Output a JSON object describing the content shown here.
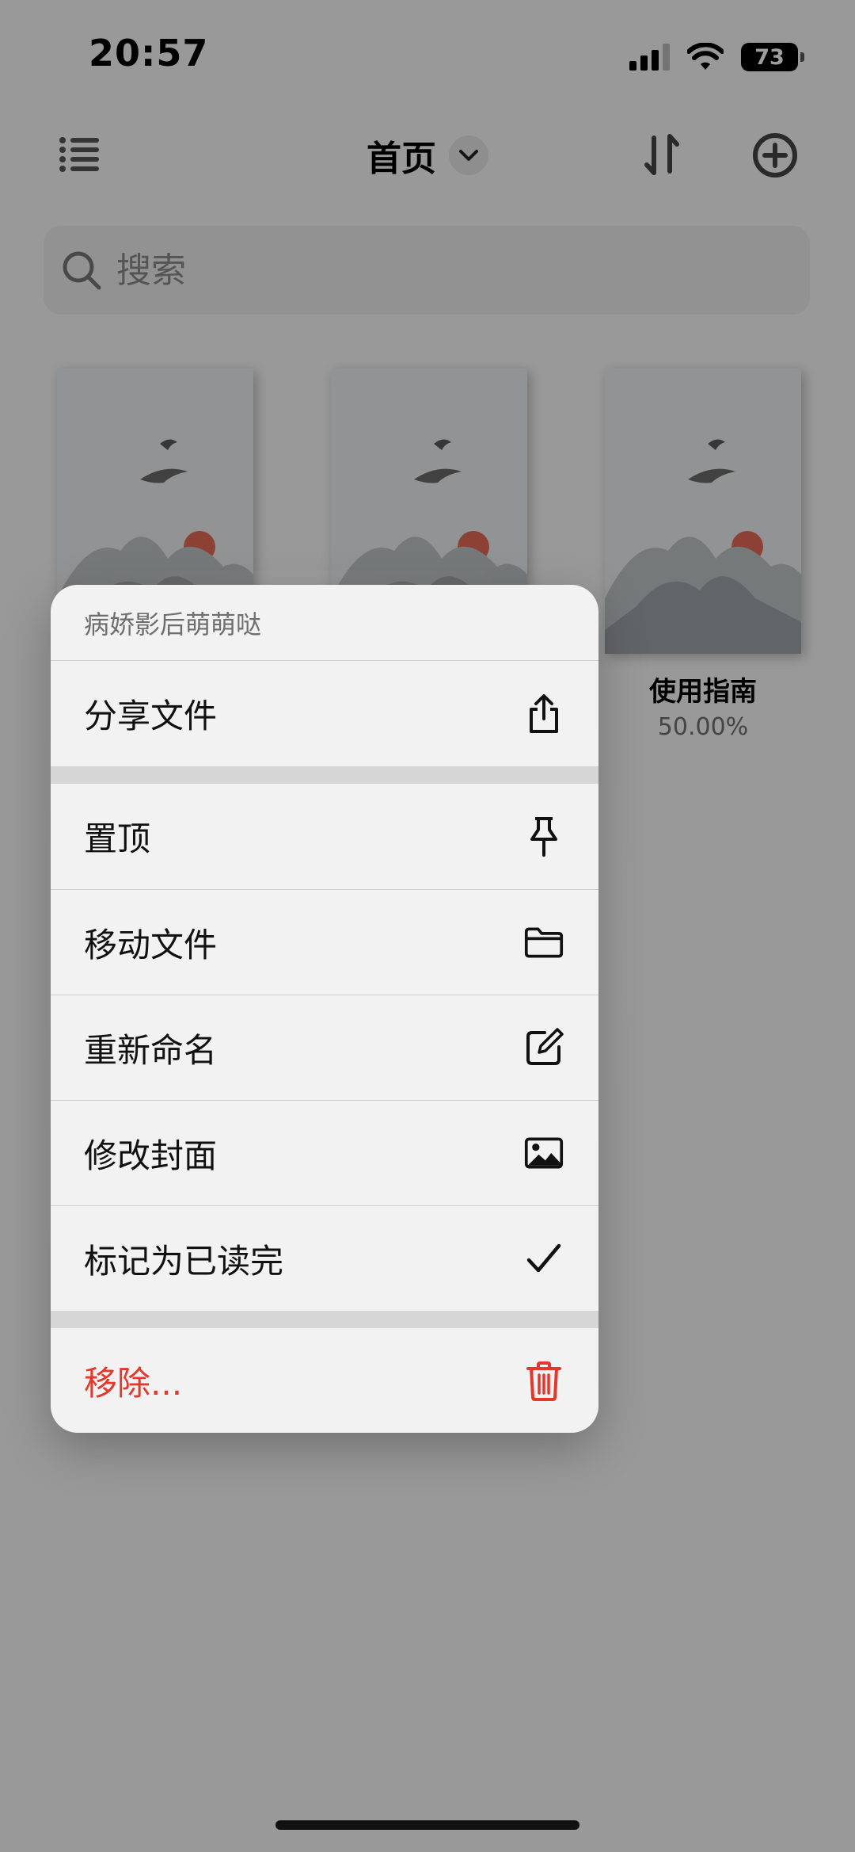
{
  "status_bar": {
    "time": "20:57",
    "battery": "73"
  },
  "nav": {
    "title": "首页",
    "icons": [
      "list-icon",
      "chevron-down-icon",
      "sort-icon",
      "add-circle-icon"
    ]
  },
  "search": {
    "placeholder": "搜索"
  },
  "books": [
    {
      "title": "",
      "progress": ""
    },
    {
      "title": "",
      "progress": ""
    },
    {
      "title": "使用指南",
      "progress": "50.00%"
    }
  ],
  "context_menu": {
    "header": "病娇影后萌萌哒",
    "items": [
      {
        "label": "分享文件",
        "icon": "share-icon"
      },
      {
        "label": "置顶",
        "icon": "pin-icon"
      },
      {
        "label": "移动文件",
        "icon": "folder-icon"
      },
      {
        "label": "重新命名",
        "icon": "edit-icon"
      },
      {
        "label": "修改封面",
        "icon": "image-icon"
      },
      {
        "label": "标记为已读完",
        "icon": "checkmark-icon"
      },
      {
        "label": "移除...",
        "icon": "trash-icon"
      }
    ],
    "danger_color": "#e5372c"
  }
}
